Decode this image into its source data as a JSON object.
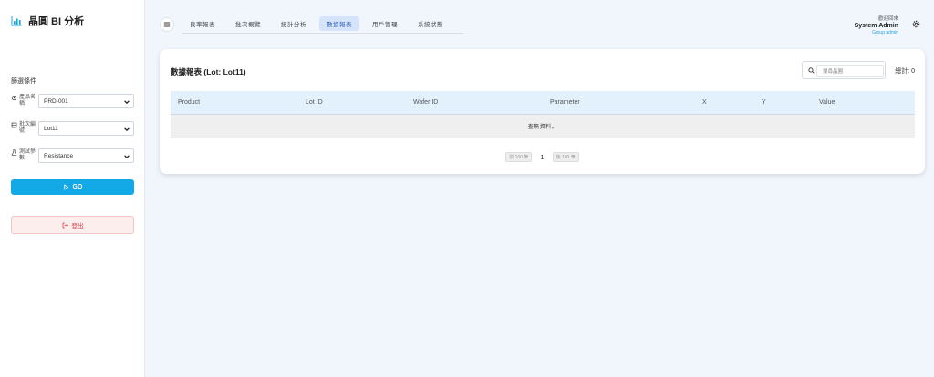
{
  "brand": {
    "name": "晶圓 BI 分析"
  },
  "sidebar": {
    "filter_heading": "篩選條件",
    "filters": [
      {
        "label": "產品名稱",
        "value": "PRD-001"
      },
      {
        "label": "批次編號",
        "value": "Lot11"
      },
      {
        "label": "測試參數",
        "value": "Resistance"
      }
    ],
    "go_label": "GO",
    "logout_label": "登出"
  },
  "tabs": [
    {
      "label": "良率報表",
      "active": false
    },
    {
      "label": "批次概覽",
      "active": false
    },
    {
      "label": "統計分析",
      "active": false
    },
    {
      "label": "數據報表",
      "active": true
    },
    {
      "label": "用戶管理",
      "active": false
    },
    {
      "label": "系統狀態",
      "active": false
    }
  ],
  "user": {
    "role": "歡迎回來",
    "name": "System Admin",
    "group": "Group admin"
  },
  "card": {
    "title": "數據報表 (Lot: Lot11)",
    "search_placeholder": "搜尋晶圓",
    "total": "總計: 0",
    "columns": [
      "Product",
      "Lot ID",
      "Wafer ID",
      "Parameter",
      "X",
      "Y",
      "Value"
    ],
    "empty_message": "查無資料。",
    "pager": {
      "prev": "前 100 筆",
      "page": "1",
      "next": "後 100 筆"
    }
  },
  "colors": {
    "accent": "#13a8e6",
    "active_tab": "#d6e4fb",
    "danger": "#d9363e"
  }
}
